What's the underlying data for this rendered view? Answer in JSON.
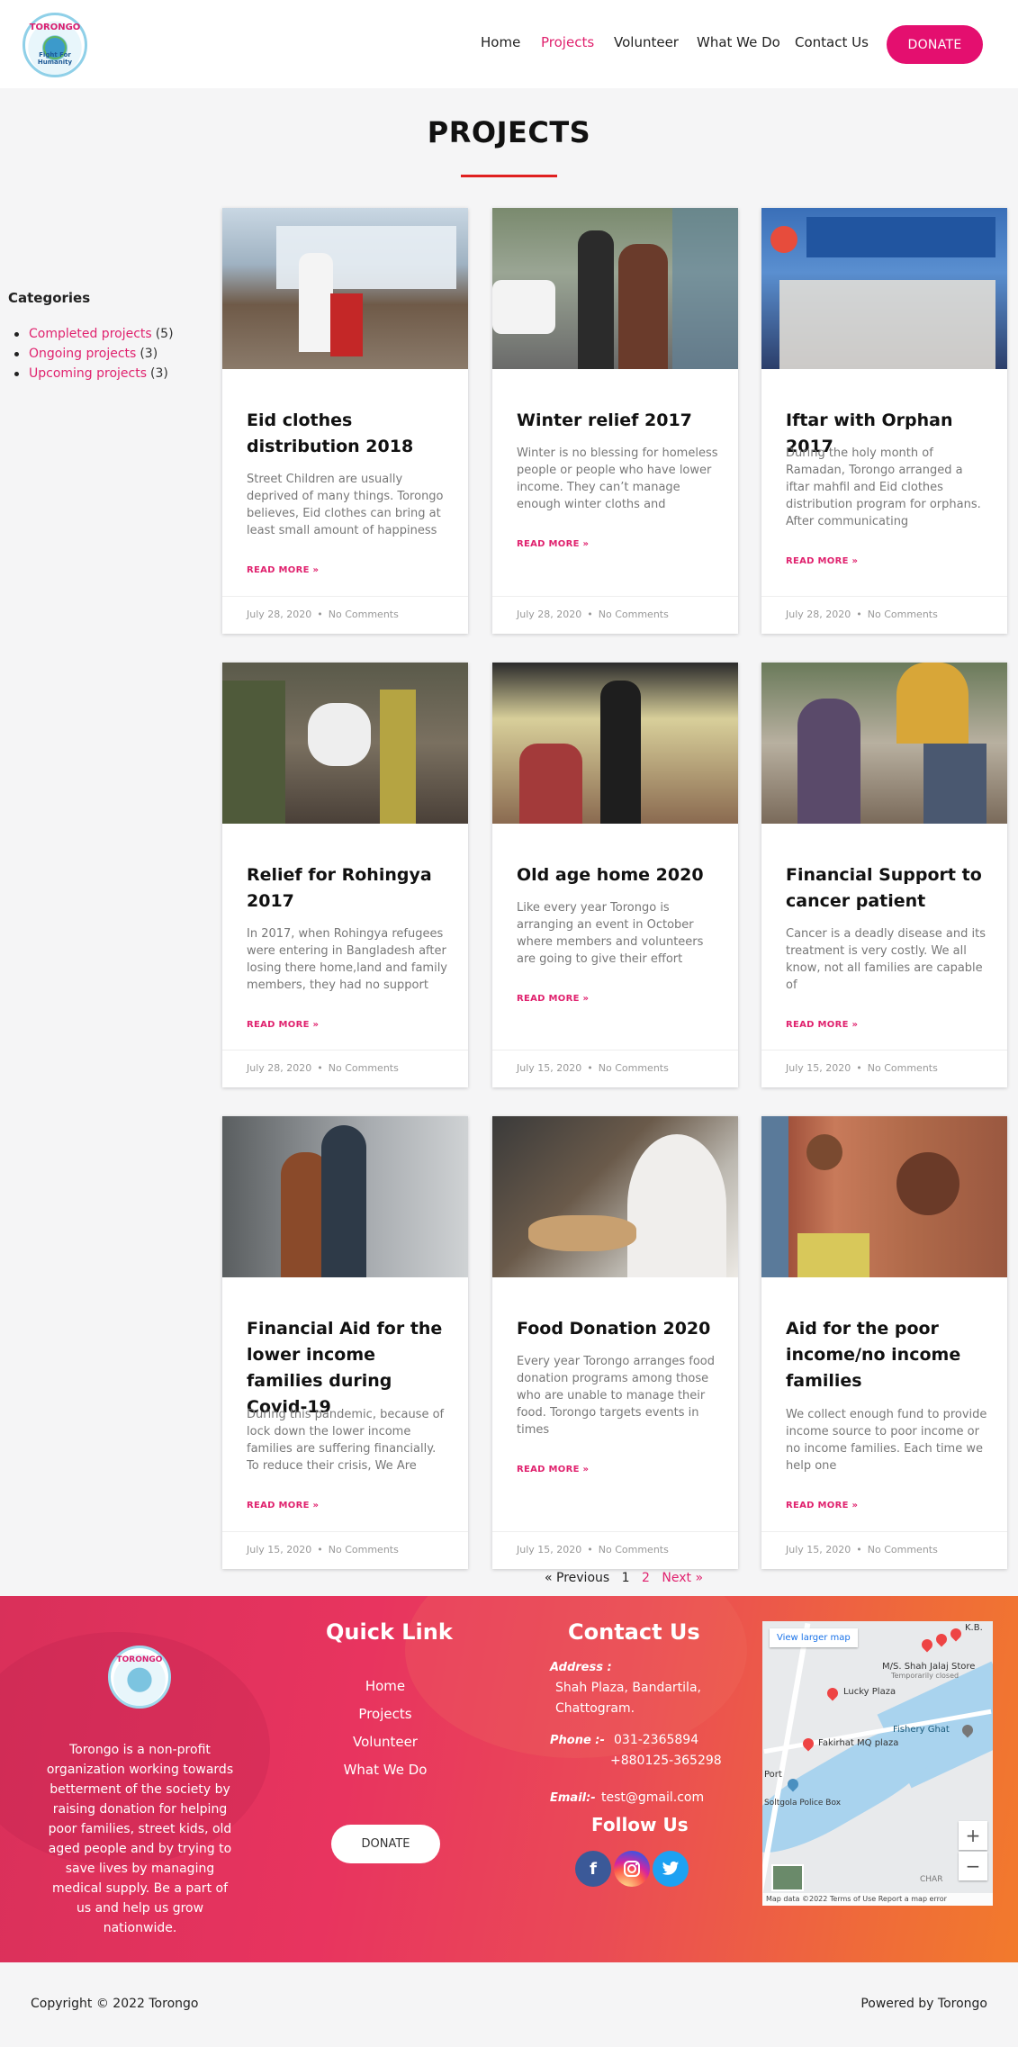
{
  "header": {
    "logo_text": "TORONGO",
    "logo_tagline": "Fight For Humanity",
    "nav": [
      "Home",
      "Projects",
      "Volunteer",
      "What We Do",
      "Contact Us"
    ],
    "active_nav": "Projects",
    "donate_label": "DONATE",
    "accent_color": "#e40f6f"
  },
  "page": {
    "title": "PROJECTS"
  },
  "sidebar": {
    "title": "Categories",
    "items": [
      {
        "label": "Completed projects",
        "count": "(5)"
      },
      {
        "label": "Ongoing projects",
        "count": "(3)"
      },
      {
        "label": "Upcoming projects",
        "count": "(3)"
      }
    ]
  },
  "cards": [
    {
      "title": "Eid clothes distribution 2018",
      "excerpt": "Street Children are usually deprived of many things. Torongo believes, Eid clothes can bring at least small amount of happiness",
      "read_more": "READ MORE »",
      "date": "July 28, 2020",
      "comments": "No Comments"
    },
    {
      "title": "Winter relief 2017",
      "excerpt": "Winter is no blessing for homeless people or people who have lower income. They can’t manage enough winter cloths and",
      "read_more": "READ MORE »",
      "date": "July 28, 2020",
      "comments": "No Comments"
    },
    {
      "title": "Iftar with Orphan 2017",
      "excerpt": "During the holy month of Ramadan, Torongo arranged a iftar mahfil and Eid clothes distribution program for orphans. After communicating",
      "read_more": "READ MORE »",
      "date": "July 28, 2020",
      "comments": "No Comments"
    },
    {
      "title": "Relief for Rohingya 2017",
      "excerpt": "In 2017, when Rohingya refugees were entering in Bangladesh after losing there home,land and family members, they had no support",
      "read_more": "READ MORE »",
      "date": "July 28, 2020",
      "comments": "No Comments"
    },
    {
      "title": "Old age home 2020",
      "excerpt": "Like every year Torongo is arranging an event in October where members and volunteers are going to give their effort",
      "read_more": "READ MORE »",
      "date": "July 15, 2020",
      "comments": "No Comments"
    },
    {
      "title": "Financial Support to cancer patient",
      "excerpt": "Cancer is a deadly disease and its treatment is very costly. We all know, not all families are capable of",
      "read_more": "READ MORE »",
      "date": "July 15, 2020",
      "comments": "No Comments"
    },
    {
      "title": "Financial Aid for the lower income families during Covid-19",
      "excerpt": "During this pandemic, because of lock down the lower income families are suffering financially. To reduce their crisis, We Are",
      "read_more": "READ MORE »",
      "date": "July 15, 2020",
      "comments": "No Comments"
    },
    {
      "title": "Food Donation 2020",
      "excerpt": "Every year Torongo arranges food donation programs among those who are unable to manage their food. Torongo targets events in times",
      "read_more": "READ MORE »",
      "date": "July 15, 2020",
      "comments": "No Comments"
    },
    {
      "title": "Aid for the poor income/no income families",
      "excerpt": "We collect enough fund to provide income source to poor income or no income families. Each time we help one",
      "read_more": "READ MORE »",
      "date": "July 15, 2020",
      "comments": "No Comments"
    }
  ],
  "pagination": {
    "previous": "« Previous",
    "page1": "1",
    "page2": "2",
    "next": "Next »"
  },
  "footer": {
    "logo_text": "TORONGO",
    "about": "Torongo is a non-profit organization working towards betterment of the society by raising donation for helping poor families, street kids, old aged people and by trying to save lives by managing medical supply. Be a part of us and help us grow nationwide.",
    "quick_link_title": "Quick Link",
    "quick_links": [
      "Home",
      "Projects",
      "Volunteer",
      "What We Do"
    ],
    "donate_label": "DONATE",
    "contact_title": "Contact Us",
    "address_label": "Address :",
    "address_line1": "Shah Plaza, Bandartila,",
    "address_line2": "Chattogram.",
    "phone_label": "Phone :-",
    "phone1": "031-2365894",
    "phone2": "+880125-365298",
    "email_label": "Email:-",
    "email": "test@gmail.com",
    "follow_title": "Follow Us",
    "social": [
      "facebook-icon",
      "instagram-icon",
      "twitter-icon"
    ],
    "map": {
      "view_larger": "View larger map",
      "labels": [
        "M/S. Shah Jalaj Store",
        "Temporarily closed",
        "Lucky Plaza",
        "Fishery Ghat",
        "Fakirhat MQ plaza",
        "Port",
        "Soltgola Police Box",
        "CHAR",
        "K.B."
      ],
      "attribution": "Map data ©2022  Terms of Use  Report a map error"
    }
  },
  "copyright": {
    "left": "Copyright © 2022 Torongo",
    "right": "Powered by Torongo"
  }
}
